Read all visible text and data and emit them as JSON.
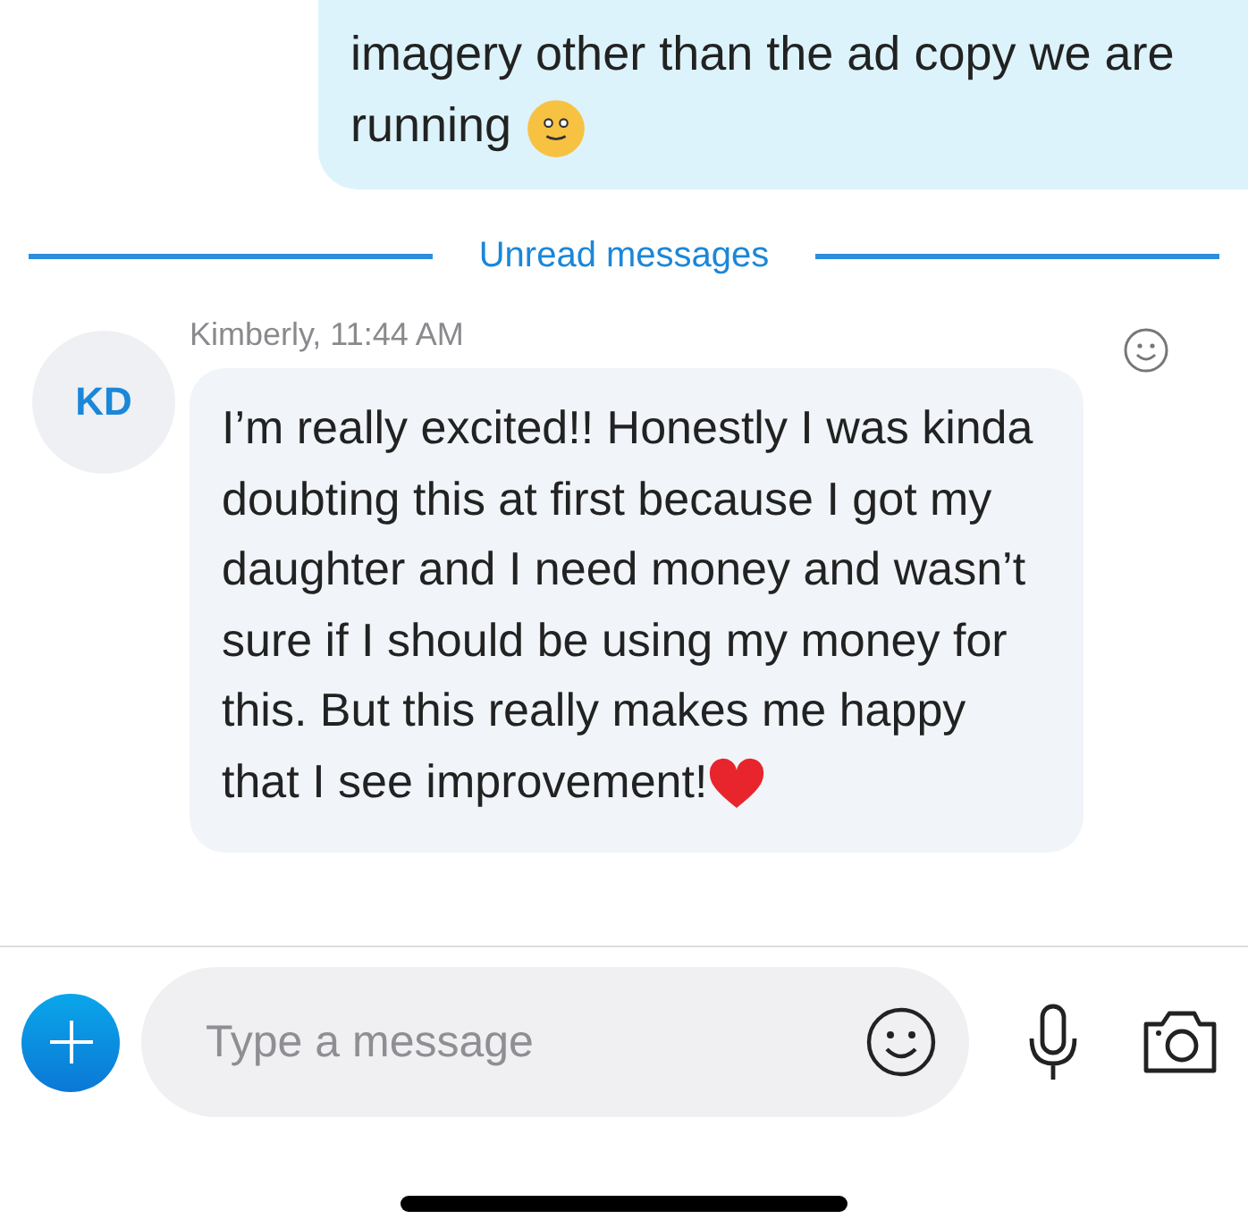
{
  "messages": [
    {
      "kind": "outgoing",
      "text": "imagery other than the ad copy we are running",
      "emoji": {
        "kind": "smile"
      }
    },
    {
      "kind": "divider",
      "text": "Unread messages"
    },
    {
      "kind": "incoming",
      "avatar": "KD",
      "sender": "Kimberly, 11:44 AM",
      "text": "I’m really excited!! Honestly I was kinda doubting this at first because I got my daughter and I need money and wasn’t sure if I should be using my money for this. But this really makes me happy  that I see improvement!",
      "emoji": {
        "kind": "heart"
      }
    }
  ],
  "composer": {
    "placeholder": "Type a message"
  }
}
